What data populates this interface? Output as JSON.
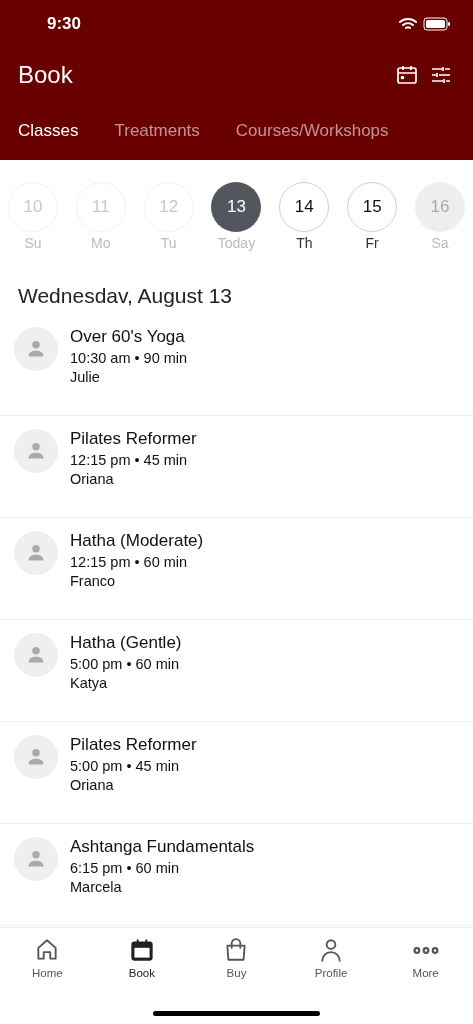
{
  "status_bar": {
    "time": "9:30"
  },
  "header": {
    "title": "Book"
  },
  "tabs": [
    {
      "label": "Classes",
      "selected": true
    },
    {
      "label": "Treatments",
      "selected": false
    },
    {
      "label": "Courses/Workshops",
      "selected": false
    }
  ],
  "days": [
    {
      "number": "10",
      "label": "Su",
      "kind": "past",
      "selected": false
    },
    {
      "number": "11",
      "label": "Mo",
      "kind": "past",
      "selected": false
    },
    {
      "number": "12",
      "label": "Tu",
      "kind": "past",
      "selected": false
    },
    {
      "number": "13",
      "label": "Today",
      "kind": "today",
      "selected": true
    },
    {
      "number": "14",
      "label": "Th",
      "kind": "future",
      "selected": false
    },
    {
      "number": "15",
      "label": "Fr",
      "kind": "future",
      "selected": false
    },
    {
      "number": "16",
      "label": "Sa",
      "kind": "unavailable",
      "selected": false
    }
  ],
  "date_heading": "Wednesdav, August 13",
  "classes": [
    {
      "name": "Over 60's Yoga",
      "time": "10:30 am • 90 min",
      "instructor": "Julie"
    },
    {
      "name": "Pilates Reformer",
      "time": "12:15 pm • 45 min",
      "instructor": "Oriana"
    },
    {
      "name": "Hatha (Moderate)",
      "time": "12:15 pm • 60 min",
      "instructor": "Franco"
    },
    {
      "name": "Hatha (Gentle)",
      "time": "5:00 pm • 60 min",
      "instructor": "Katya"
    },
    {
      "name": "Pilates Reformer",
      "time": "5:00 pm • 45 min",
      "instructor": "Oriana"
    },
    {
      "name": "Ashtanga Fundamentals",
      "time": "6:15 pm • 60 min",
      "instructor": "Marcela"
    }
  ],
  "nav": [
    {
      "label": "Home",
      "kind": "home",
      "selected": false
    },
    {
      "label": "Book",
      "kind": "book",
      "selected": true
    },
    {
      "label": "Buy",
      "kind": "buy",
      "selected": false
    },
    {
      "label": "Profile",
      "kind": "profile",
      "selected": false
    },
    {
      "label": "More",
      "kind": "more",
      "selected": false
    }
  ]
}
